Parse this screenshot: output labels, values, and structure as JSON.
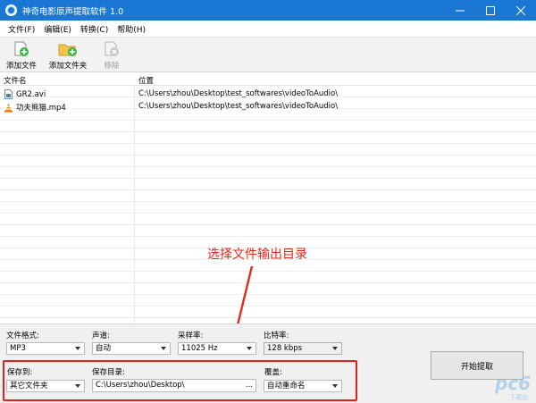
{
  "window": {
    "title": "神奇电影原声提取软件 1.0",
    "accent_color": "#1a78d4"
  },
  "menu": {
    "items": [
      "文件(F)",
      "编辑(E)",
      "转换(C)",
      "帮助(H)"
    ]
  },
  "toolbar": {
    "add_file": "添加文件",
    "add_folder": "添加文件夹",
    "remove": "移除"
  },
  "file_list": {
    "columns": [
      "文件名",
      "位置"
    ],
    "rows": [
      {
        "name": "GR2.avi",
        "path": "C:\\Users\\zhou\\Desktop\\test_softwares\\videoToAudio\\",
        "icon": "avi-file-icon"
      },
      {
        "name": "功夫熊猫.mp4",
        "path": "C:\\Users\\zhou\\Desktop\\test_softwares\\videoToAudio\\",
        "icon": "vlc-cone-icon"
      }
    ]
  },
  "annotation": {
    "text": "选择文件输出目录",
    "color": "#e2281b"
  },
  "settings": {
    "format_label": "文件格式:",
    "format_value": "MP3",
    "channel_label": "声道:",
    "channel_value": "自动",
    "samplerate_label": "采样率:",
    "samplerate_value": "11025 Hz",
    "bitrate_label": "比特率:",
    "bitrate_value": "128 kbps",
    "saveto_label": "保存到:",
    "saveto_value": "其它文件夹",
    "savedir_label": "保存目录:",
    "savedir_value": "C:\\Users\\zhou\\Desktop\\",
    "browse_label": "...",
    "overwrite_label": "覆盖:",
    "overwrite_value": "自动重命名",
    "start_label": "开始提取"
  },
  "watermark": {
    "text": "下载站"
  }
}
